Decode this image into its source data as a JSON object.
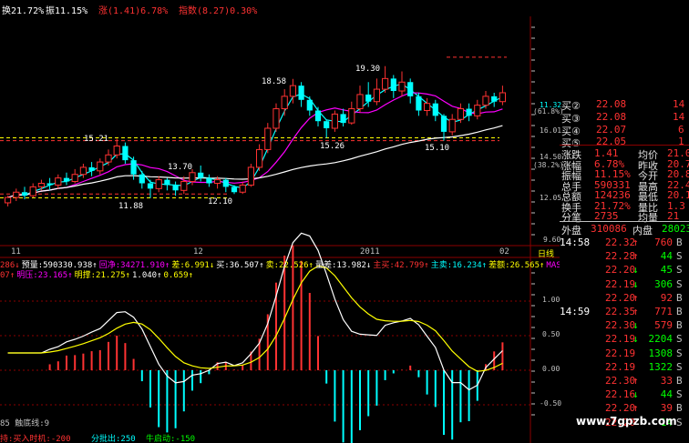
{
  "topbar": {
    "turnover": "换21.72%",
    "amplitude": "振11.15%",
    "change": "涨(1.41)6.78%",
    "index": "指数(8.27)0.30%"
  },
  "colors": {
    "up": "#ff3232",
    "down": "#00ffff",
    "ma_white": "#ffffff",
    "ma_yellow": "#ffff00",
    "ma_magenta": "#ff00ff",
    "ma_cyan": "#00ffff",
    "ma_green": "#00ff00",
    "grid": "#8b0000",
    "yellow_text": "#ffff00"
  },
  "price_axis": {
    "top_partial": "11.32",
    "pct": "(61.8%)",
    "labels": [
      "16.01",
      "14.50",
      "(38.2%)",
      "12.05",
      "9.60"
    ]
  },
  "price_annotations": {
    "high_1": "15.21",
    "low_1": "11.88",
    "high_2": "13.70",
    "low_2": "12.10",
    "high_3": "18.58",
    "low_3": "15.26",
    "high_4": "19.30",
    "low_4": "15.10"
  },
  "date_axis": {
    "d1": "11",
    "d2": "12",
    "d3": "2011",
    "d4": "02",
    "period": "日线"
  },
  "indicator_bar": {
    "a": "286↓",
    "b": "预量:590330.938↑",
    "c": "回净:34271.910↑",
    "d": "差:6.991↓",
    "e": "买:36.507↑",
    "f": "卖:22.526↑",
    "g": "量差:13.982↓",
    "h": "主买:42.799↑",
    "i": "主卖:16.234↑",
    "j": "差额:26.565↑",
    "k": "MAS:5212"
  },
  "indicator_bar2": {
    "a": "07↑",
    "b": "明压:23.165↑",
    "c": "明撑:21.275↑",
    "d": "1.040↑",
    "e": "0.659↑"
  },
  "osc_axis": [
    "1.00",
    "0.50",
    "0.00",
    "-0.50"
  ],
  "osc_label": "85 触底线:9",
  "bottom_bar": {
    "buy": "持:买入时机:-200",
    "out": "分批出:250",
    "start": "牛启动:-150"
  },
  "quote": {
    "bids": [
      {
        "label": "买②",
        "price": "22.08",
        "vol": "14"
      },
      {
        "label": "买③",
        "price": "22.08",
        "vol": "14"
      },
      {
        "label": "买④",
        "price": "22.07",
        "vol": "6"
      },
      {
        "label": "买⑤",
        "price": "22.05",
        "vol": "1"
      }
    ],
    "stats": [
      {
        "l1": "涨跌",
        "v1": "1.41",
        "l2": "均价",
        "v2": "21.0"
      },
      {
        "l1": "涨幅",
        "v1": "6.78%",
        "l2": "昨收",
        "v2": "20.7"
      },
      {
        "l1": "振幅",
        "v1": "11.15%",
        "l2": "今开",
        "v2": "20.8"
      },
      {
        "l1": "总手",
        "v1": "590331",
        "l2": "最高",
        "v2": "22.4"
      },
      {
        "l1": "总额",
        "v1": "124236",
        "l2": "最低",
        "v2": "20.1"
      },
      {
        "l1": "换手",
        "v1": "21.72%",
        "l2": "量比",
        "v2": "1.3"
      },
      {
        "l1": "分笔",
        "v1": "2735",
        "l2": "均量",
        "v2": "21"
      }
    ],
    "outer": {
      "label": "外盘",
      "value": "310086",
      "label2": "内盘",
      "value2": "28023"
    }
  },
  "ticks": [
    {
      "time": "14:58",
      "price": "22.32",
      "dir": "↑",
      "vol": "760",
      "side": "B"
    },
    {
      "time": "",
      "price": "22.28",
      "dir": "↑",
      "vol": "44",
      "side": "S"
    },
    {
      "time": "",
      "price": "22.20",
      "dir": "↓",
      "vol": "45",
      "side": "S"
    },
    {
      "time": "",
      "price": "22.19",
      "dir": "↓",
      "vol": "306",
      "side": "S"
    },
    {
      "time": "",
      "price": "22.20",
      "dir": "↑",
      "vol": "92",
      "side": "B"
    },
    {
      "time": "14:59",
      "price": "22.35",
      "dir": "↑",
      "vol": "771",
      "side": "B"
    },
    {
      "time": "",
      "price": "22.30",
      "dir": "↓",
      "vol": "579",
      "side": "B"
    },
    {
      "time": "",
      "price": "22.19",
      "dir": "↓",
      "vol": "2204",
      "side": "S"
    },
    {
      "time": "",
      "price": "22.19",
      "dir": "",
      "vol": "1308",
      "side": "S"
    },
    {
      "time": "",
      "price": "22.19",
      "dir": "",
      "vol": "1322",
      "side": "S"
    },
    {
      "time": "",
      "price": "22.30",
      "dir": "↑",
      "vol": "33",
      "side": "B"
    },
    {
      "time": "",
      "price": "22.16",
      "dir": "↓",
      "vol": "44",
      "side": "S"
    },
    {
      "time": "",
      "price": "22.20",
      "dir": "↑",
      "vol": "39",
      "side": "B"
    },
    {
      "time": "",
      "price": "22.20",
      "dir": "",
      "vol": "14",
      "side": "S"
    }
  ],
  "watermark": "www.7gpzb.com",
  "chart_data": {
    "type": "candlestick",
    "ylim": [
      9.6,
      22.0
    ],
    "candles": [
      [
        11.6,
        11.9,
        11.4,
        12.0
      ],
      [
        11.9,
        12.2,
        11.7,
        12.4
      ],
      [
        12.2,
        12.0,
        11.8,
        12.5
      ],
      [
        12.0,
        12.5,
        11.9,
        12.7
      ],
      [
        12.5,
        12.7,
        12.3,
        12.9
      ],
      [
        12.7,
        12.6,
        12.3,
        13.0
      ],
      [
        12.6,
        13.0,
        12.4,
        13.2
      ],
      [
        13.0,
        12.8,
        12.6,
        13.3
      ],
      [
        12.8,
        13.2,
        12.7,
        13.5
      ],
      [
        13.2,
        13.6,
        13.0,
        13.8
      ],
      [
        13.6,
        13.4,
        13.1,
        13.9
      ],
      [
        13.4,
        13.9,
        13.2,
        14.1
      ],
      [
        13.9,
        14.3,
        13.7,
        14.6
      ],
      [
        14.3,
        14.8,
        14.1,
        15.21
      ],
      [
        14.8,
        14.0,
        13.8,
        15.0
      ],
      [
        14.0,
        13.2,
        12.9,
        14.2
      ],
      [
        13.2,
        12.7,
        12.4,
        13.4
      ],
      [
        12.7,
        12.4,
        11.88,
        12.9
      ],
      [
        12.4,
        12.9,
        12.2,
        13.1
      ],
      [
        12.9,
        12.6,
        12.3,
        13.0
      ],
      [
        12.6,
        12.3,
        12.0,
        12.8
      ],
      [
        12.3,
        12.8,
        12.1,
        13.1
      ],
      [
        12.8,
        13.3,
        12.6,
        13.5
      ],
      [
        13.3,
        13.0,
        12.8,
        13.7
      ],
      [
        13.0,
        12.7,
        12.5,
        13.2
      ],
      [
        12.7,
        12.9,
        12.4,
        13.1
      ],
      [
        12.9,
        12.5,
        12.2,
        13.0
      ],
      [
        12.5,
        12.2,
        12.1,
        12.6
      ],
      [
        12.2,
        12.6,
        12.1,
        12.8
      ],
      [
        12.6,
        13.6,
        12.5,
        13.8
      ],
      [
        13.6,
        14.6,
        13.4,
        14.9
      ],
      [
        14.6,
        15.8,
        14.4,
        16.1
      ],
      [
        15.8,
        16.9,
        15.6,
        17.2
      ],
      [
        16.9,
        17.6,
        16.5,
        18.0
      ],
      [
        17.6,
        18.2,
        17.2,
        18.58
      ],
      [
        18.2,
        17.4,
        17.0,
        18.4
      ],
      [
        17.4,
        16.8,
        16.5,
        17.6
      ],
      [
        16.8,
        16.2,
        15.9,
        17.0
      ],
      [
        16.2,
        15.8,
        15.26,
        16.3
      ],
      [
        15.8,
        16.6,
        15.6,
        16.8
      ],
      [
        16.6,
        16.1,
        15.9,
        16.9
      ],
      [
        16.1,
        16.9,
        16.0,
        17.3
      ],
      [
        16.9,
        17.7,
        16.7,
        18.2
      ],
      [
        17.7,
        17.3,
        17.0,
        18.4
      ],
      [
        17.3,
        18.0,
        17.1,
        18.6
      ],
      [
        18.0,
        18.6,
        17.8,
        19.3
      ],
      [
        18.6,
        17.9,
        17.5,
        18.8
      ],
      [
        17.9,
        18.4,
        17.6,
        19.0
      ],
      [
        18.4,
        17.6,
        17.2,
        18.6
      ],
      [
        17.6,
        16.8,
        16.5,
        17.8
      ],
      [
        16.8,
        17.2,
        16.5,
        17.5
      ],
      [
        17.2,
        16.5,
        16.2,
        17.4
      ],
      [
        16.5,
        15.6,
        15.1,
        16.6
      ],
      [
        15.6,
        16.3,
        15.4,
        16.6
      ],
      [
        16.3,
        16.9,
        16.1,
        17.2
      ],
      [
        16.9,
        16.5,
        16.2,
        17.2
      ],
      [
        16.5,
        17.1,
        16.3,
        17.4
      ],
      [
        17.1,
        17.6,
        16.9,
        17.9
      ],
      [
        17.6,
        17.3,
        17.0,
        17.8
      ],
      [
        17.3,
        17.8,
        17.1,
        18.2
      ]
    ]
  }
}
